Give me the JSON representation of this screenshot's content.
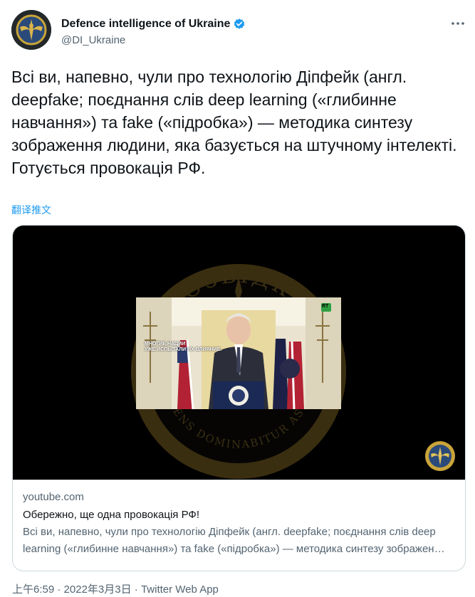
{
  "account": {
    "display_name": "Defence intelligence of Ukraine",
    "handle": "@DI_Ukraine"
  },
  "tweet": {
    "text": "Всі ви, напевно, чули про технологію Діпфейк (англ. deepfake; поєднання слів deep learning («глибинне навчання») та fake («підробка») — методика синтезу зображення людини, яка базується на штучному інтелекті.\nГотується провокація РФ.",
    "translate_label": "翻译推文"
  },
  "card": {
    "domain": "youtube.com",
    "title": "Обережно, ще одна провокація РФ!",
    "description": "Всі ви, напевно, чули про технологію Діпфейк (англ. deepfake; поєднання слів deep learning («глибинне навчання») та fake («підробка») — методика синтезу зображення людини, яка базується на штучному інтелекті.",
    "media": {
      "watermark_top": "РОЗВІДКА",
      "watermark_bottom": "SAPIENS DOMINABITUR ASTRIS",
      "caption": "МНОГИЕ НАЦИИ\nУЖЕ ИСПЫТАЛИ ИХ ВЛИЯНИЕ.",
      "channel_badge": "RT"
    }
  },
  "footer": {
    "time": "上午6:59",
    "date": "2022年3月3日",
    "source": "Twitter Web App",
    "separator": " · "
  },
  "colors": {
    "link": "#1d9bf0",
    "secondary_text": "#536471",
    "border": "#cfd9de"
  }
}
